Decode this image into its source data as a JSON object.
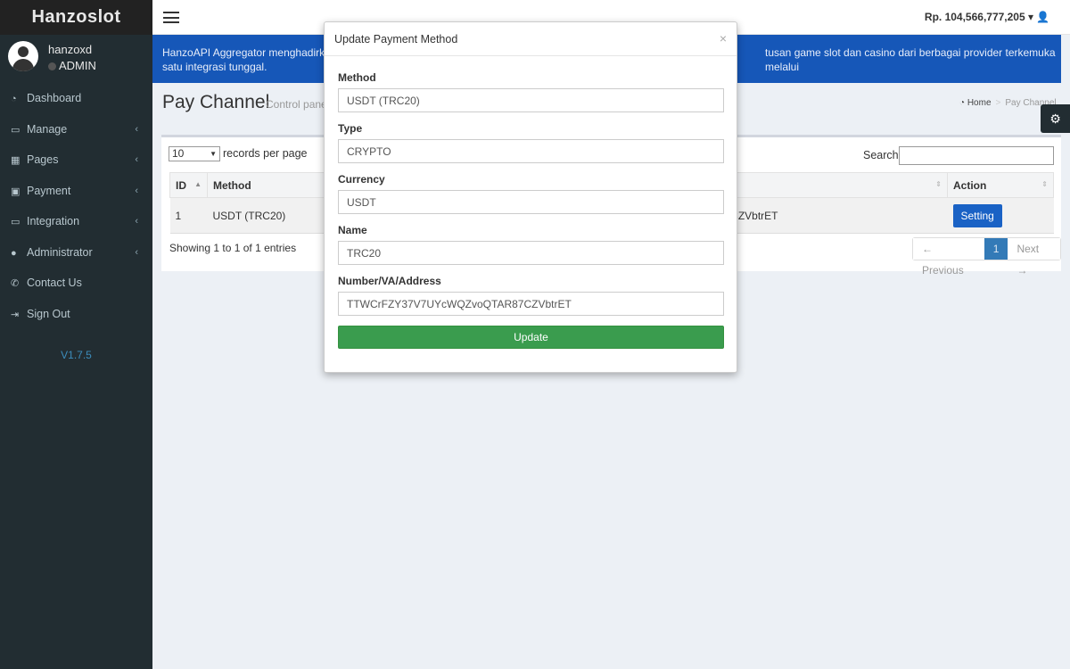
{
  "app": {
    "name": "Hanzoslot",
    "version": "V1.7.5"
  },
  "user": {
    "name": "hanzoxd",
    "role": "ADMIN"
  },
  "sidebar": {
    "items": [
      {
        "label": "Dashboard",
        "icon": "dashboard-icon",
        "submenu": false
      },
      {
        "label": "Manage",
        "icon": "laptop-icon",
        "submenu": true
      },
      {
        "label": "Pages",
        "icon": "table-icon",
        "submenu": true
      },
      {
        "label": "Payment",
        "icon": "money-icon",
        "submenu": true
      },
      {
        "label": "Integration",
        "icon": "laptop-icon",
        "submenu": true
      },
      {
        "label": "Administrator",
        "icon": "user-icon",
        "submenu": true
      },
      {
        "label": "Contact Us",
        "icon": "phone-icon",
        "submenu": false
      },
      {
        "label": "Sign Out",
        "icon": "sign-out-icon",
        "submenu": false
      }
    ]
  },
  "topbar": {
    "balance": "Rp. 104,566,777,205"
  },
  "banner": {
    "text": "HanzoAPI Aggregator menghadirkan",
    "text_right": "tusan game slot dan casino dari berbagai provider terkemuka melalui",
    "text_line2": "satu integrasi tunggal."
  },
  "page": {
    "title": "Pay Channel",
    "subtitle": "Control panel",
    "breadcrumb": {
      "home": "Home",
      "current": "Pay Channel"
    }
  },
  "table": {
    "length_value": "10",
    "length_label": "records per page",
    "search_label": "Search:",
    "columns": [
      "ID",
      "Method",
      "Action"
    ],
    "rows": [
      {
        "id": "1",
        "method": "USDT (TRC20)",
        "address_fragment": "7CZVbtrET",
        "action": "Setting"
      }
    ],
    "info": "Showing 1 to 1 of 1 entries",
    "pagination": {
      "previous": "← Previous",
      "page": "1",
      "next": "Next →"
    }
  },
  "modal": {
    "title": "Update Payment Method",
    "close": "×",
    "fields": {
      "method": {
        "label": "Method",
        "value": "USDT (TRC20)"
      },
      "type": {
        "label": "Type",
        "value": "CRYPTO"
      },
      "currency": {
        "label": "Currency",
        "value": "USDT"
      },
      "name": {
        "label": "Name",
        "value": "TRC20"
      },
      "address": {
        "label": "Number/VA/Address",
        "value": "TTWCrFZY37V7UYcWQZvoQTAR87CZVbtrET"
      }
    },
    "submit": "Update"
  },
  "colors": {
    "sidebar_bg": "#222d32",
    "banner_bg": "#1657b8",
    "primary_button": "#1a62c5",
    "update_button": "#3a9c4e"
  }
}
